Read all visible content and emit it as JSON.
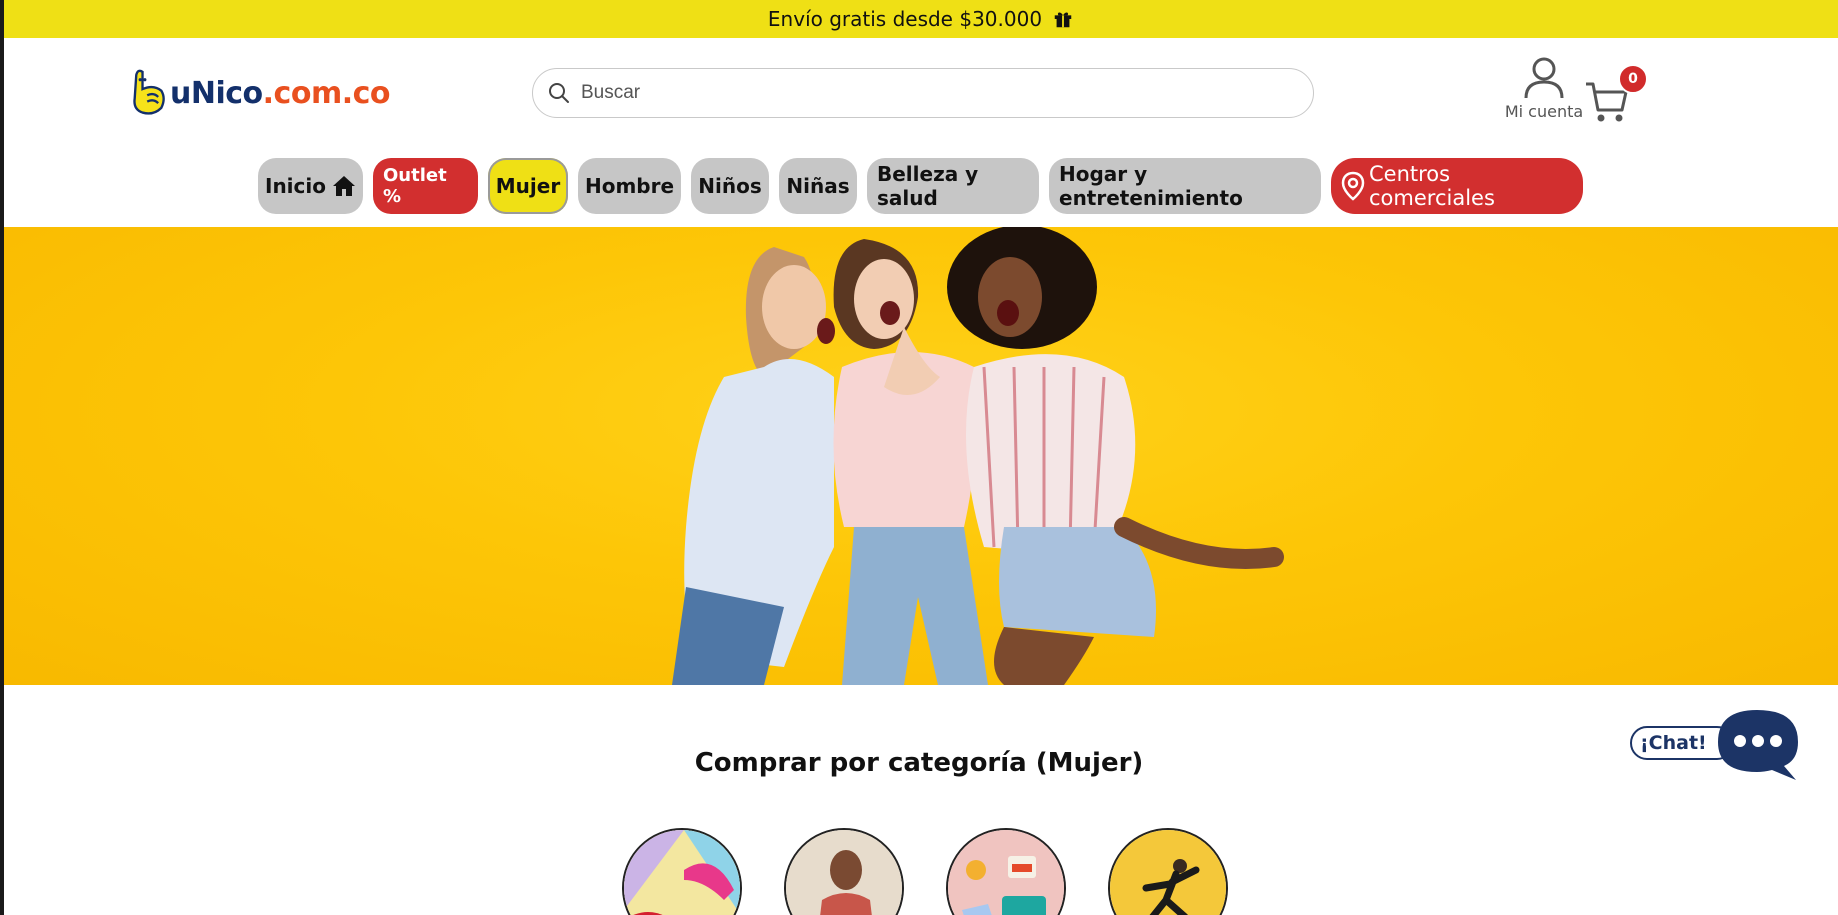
{
  "announcement": {
    "text": "Envío gratis desde $30.000",
    "icon": "gift-icon"
  },
  "header": {
    "logo_text_a": "uNico",
    "logo_text_b": ".com.co",
    "search": {
      "placeholder": "Buscar",
      "value": ""
    },
    "account_label": "Mi cuenta",
    "cart_count": "0"
  },
  "nav": {
    "items": [
      {
        "label": "Inicio",
        "icon": "home-icon"
      },
      {
        "label": "Outlet %"
      },
      {
        "label": "Mujer",
        "active": true
      },
      {
        "label": "Hombre"
      },
      {
        "label": "Niños"
      },
      {
        "label": "Niñas"
      },
      {
        "label": "Belleza y salud"
      },
      {
        "label": "Hogar y entretenimiento"
      },
      {
        "label": "Centros comerciales",
        "icon": "location-pin-icon"
      }
    ]
  },
  "chat": {
    "label": "¡Chat!"
  },
  "categories": {
    "title": "Comprar por categoría (Mujer)"
  },
  "colors": {
    "brand_yellow": "#efe015",
    "brand_red": "#d22f2f",
    "brand_navy": "#13306b",
    "brand_orange": "#e9501f",
    "pill_gray": "#c6c6c6"
  }
}
